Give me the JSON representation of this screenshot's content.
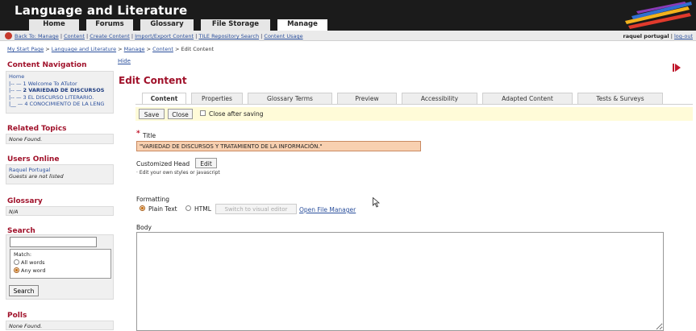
{
  "site": {
    "title": "Language and Literature"
  },
  "main_tabs": [
    {
      "label": "Home"
    },
    {
      "label": "Forums"
    },
    {
      "label": "Glossary"
    },
    {
      "label": "File Storage"
    },
    {
      "label": "Manage"
    }
  ],
  "subnav": {
    "items": [
      "Back To: Manage",
      "Content",
      "Create Content",
      "Import/Export Content",
      "TILE Repository Search",
      "Content Usage"
    ],
    "sep": " | "
  },
  "user": {
    "name": "raquel portugal",
    "logout": "log-out",
    "sep": " | "
  },
  "breadcrumb": {
    "links": [
      "My Start Page",
      "Language and Literature",
      "Manage",
      "Content"
    ],
    "current": "Edit Content",
    "sep": " > "
  },
  "sidebar": {
    "hide": "Hide",
    "content_nav": {
      "title": "Content Navigation",
      "home": "Home",
      "items": [
        "1 Welcome To ATutor",
        "2 VARIEDAD DE DISCURSOS",
        "3 EL DISCURSO LITERARIO.",
        "4 CONOCIMIENTO DE LA LENG"
      ]
    },
    "related": {
      "title": "Related Topics",
      "value": "None Found."
    },
    "users": {
      "title": "Users Online",
      "user": "Raquel Portugal",
      "note": "Guests are not listed"
    },
    "glossary": {
      "title": "Glossary",
      "value": "N/A"
    },
    "search": {
      "title": "Search",
      "match": "Match:",
      "all": "All words",
      "any": "Any word",
      "button": "Search"
    },
    "polls": {
      "title": "Polls",
      "value": "None Found."
    }
  },
  "editor": {
    "heading": "Edit Content",
    "tabs": [
      "Content",
      "Properties",
      "Glossary Terms",
      "Preview",
      "Accessibility",
      "Adapted Content",
      "Tests & Surveys"
    ],
    "save": "Save",
    "close": "Close",
    "close_after": "Close after saving",
    "required_mark": "*",
    "title_label": "Title",
    "title_value": "\"VARIEDAD DE DISCURSOS Y TRATAMIENTO DE LA INFORMACIÓN.\"",
    "custom_head": "Customized Head",
    "edit": "Edit",
    "custom_head_note": "· Edit your own styles or javascript",
    "formatting": "Formatting",
    "plain_text": "Plain Text",
    "html": "HTML",
    "switch_visual": "Switch to visual editor",
    "file_manager": "Open File Manager",
    "body_label": "Body"
  },
  "colors": {
    "header_bg": "#1b1b1b",
    "section_title": "#a0112a",
    "link": "#2a4f9c",
    "title_input_bg": "#f8d0b0",
    "save_bar": "#fffbd8"
  },
  "icons": [
    "back-icon",
    "pencils-logo-icon",
    "collapse-arrow-icon",
    "mouse-cursor-icon"
  ]
}
